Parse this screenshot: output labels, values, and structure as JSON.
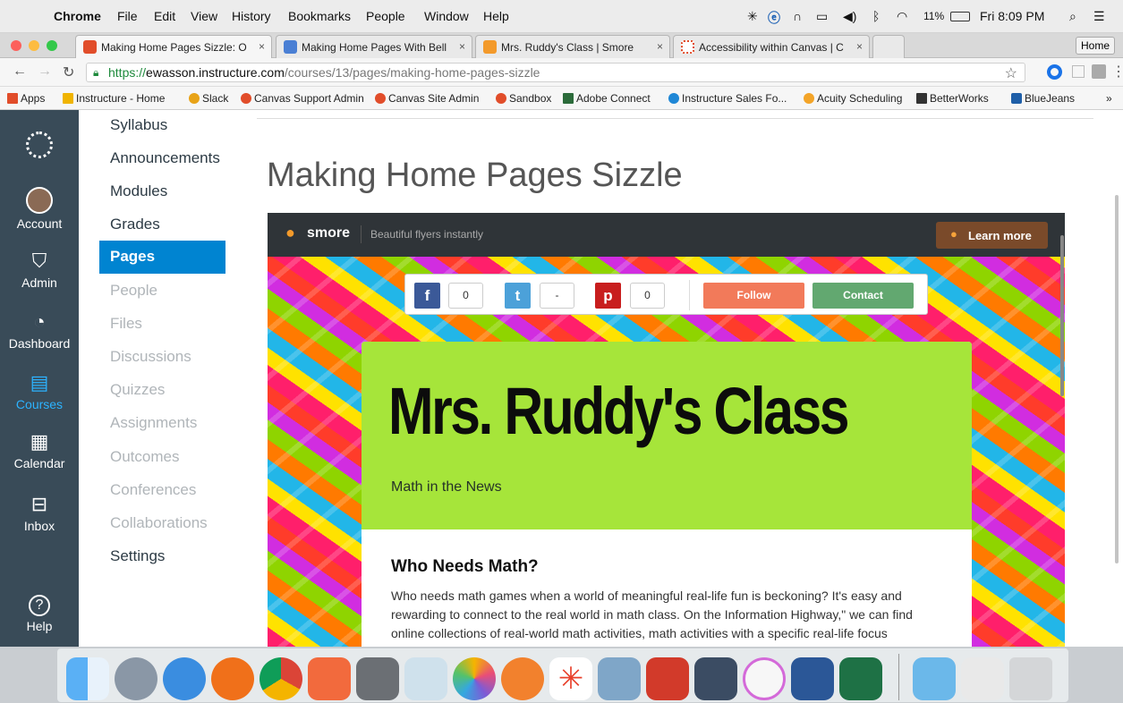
{
  "menubar": {
    "apple": "",
    "items": [
      "Chrome",
      "File",
      "Edit",
      "View",
      "History",
      "Bookmarks",
      "People",
      "Window",
      "Help"
    ],
    "battery": "11%",
    "clock": "Fri 8:09 PM"
  },
  "tabs": [
    {
      "title": "Making Home Pages Sizzle: O",
      "close": "×",
      "color": "#e14d2a"
    },
    {
      "title": "Making Home Pages With Bell",
      "close": "×",
      "color": "#4a7fd4"
    },
    {
      "title": "Mrs. Ruddy's Class | Smore",
      "close": "×",
      "color": "#f39a2b"
    },
    {
      "title": "Accessibility within Canvas | C",
      "close": "×",
      "color": "#ffffff"
    }
  ],
  "profile_button": "Home",
  "address": {
    "scheme": "https://",
    "host": "ewasson.instructure.com",
    "path": "/courses/13/pages/making-home-pages-sizzle"
  },
  "bookmarks": [
    {
      "label": "Apps",
      "color": "#e14d2a"
    },
    {
      "label": "Instructure - Home",
      "color": "#f0b400"
    },
    {
      "label": "Slack",
      "color": "#e8a317"
    },
    {
      "label": "Canvas Support Admin",
      "color": "#e14d2a"
    },
    {
      "label": "Canvas Site Admin",
      "color": "#e14d2a"
    },
    {
      "label": "Sandbox",
      "color": "#e14d2a"
    },
    {
      "label": "Adobe Connect",
      "color": "#2b6b3a"
    },
    {
      "label": "Instructure Sales Fo...",
      "color": "#1f87d6"
    },
    {
      "label": "Acuity Scheduling",
      "color": "#f3a428"
    },
    {
      "label": "BetterWorks",
      "color": "#333333"
    },
    {
      "label": "BlueJeans",
      "color": "#1f5fa8"
    }
  ],
  "bookmarks_overflow": "»",
  "global_nav": [
    {
      "label": "",
      "icon": "canvas-logo-icon"
    },
    {
      "label": "Account",
      "icon": "avatar-icon"
    },
    {
      "label": "Admin",
      "icon": "shield-icon"
    },
    {
      "label": "Dashboard",
      "icon": "dashboard-icon"
    },
    {
      "label": "Courses",
      "icon": "courses-icon"
    },
    {
      "label": "Calendar",
      "icon": "calendar-icon"
    },
    {
      "label": "Inbox",
      "icon": "inbox-icon"
    },
    {
      "label": "Help",
      "icon": "help-icon"
    }
  ],
  "course_nav": [
    {
      "label": "Syllabus",
      "state": "normal"
    },
    {
      "label": "Announcements",
      "state": "normal"
    },
    {
      "label": "Modules",
      "state": "normal"
    },
    {
      "label": "Grades",
      "state": "normal"
    },
    {
      "label": "Pages",
      "state": "selected"
    },
    {
      "label": "People",
      "state": "disabled"
    },
    {
      "label": "Files",
      "state": "disabled"
    },
    {
      "label": "Discussions",
      "state": "disabled"
    },
    {
      "label": "Quizzes",
      "state": "disabled"
    },
    {
      "label": "Assignments",
      "state": "disabled"
    },
    {
      "label": "Outcomes",
      "state": "disabled"
    },
    {
      "label": "Conferences",
      "state": "disabled"
    },
    {
      "label": "Collaborations",
      "state": "disabled"
    },
    {
      "label": "Settings",
      "state": "normal"
    }
  ],
  "page_title": "Making Home Pages Sizzle",
  "smore": {
    "brand": "smore",
    "tagline": "Beautiful flyers instantly",
    "learn_more": "Learn more",
    "share": {
      "facebook_count": "0",
      "twitter_count": "-",
      "pinterest_count": "0"
    },
    "follow": "Follow",
    "contact": "Contact",
    "flyer_title": "Mrs. Ruddy's Class",
    "flyer_subtitle": "Math in the News",
    "section_heading": "Who Needs Math?",
    "section_body": "Who needs math games when a world of meaningful real-life fun is beckoning? It's easy and rewarding to connect to the real world in math class. On the Information Highway,\" we can find online collections of real-world math activities, math activities with a specific real-life focus"
  },
  "dock_apps": [
    "Finder",
    "Launchpad",
    "Safari",
    "Firefox",
    "Chrome",
    "Smore",
    "System Preferences",
    "Preview",
    "Photos",
    "iBooks",
    "Asterisk",
    "Image Capture",
    "Reeder",
    "Screen Sharing",
    "iTunes",
    "Word",
    "Excel",
    "Applications",
    "Downloads",
    "Trash"
  ]
}
